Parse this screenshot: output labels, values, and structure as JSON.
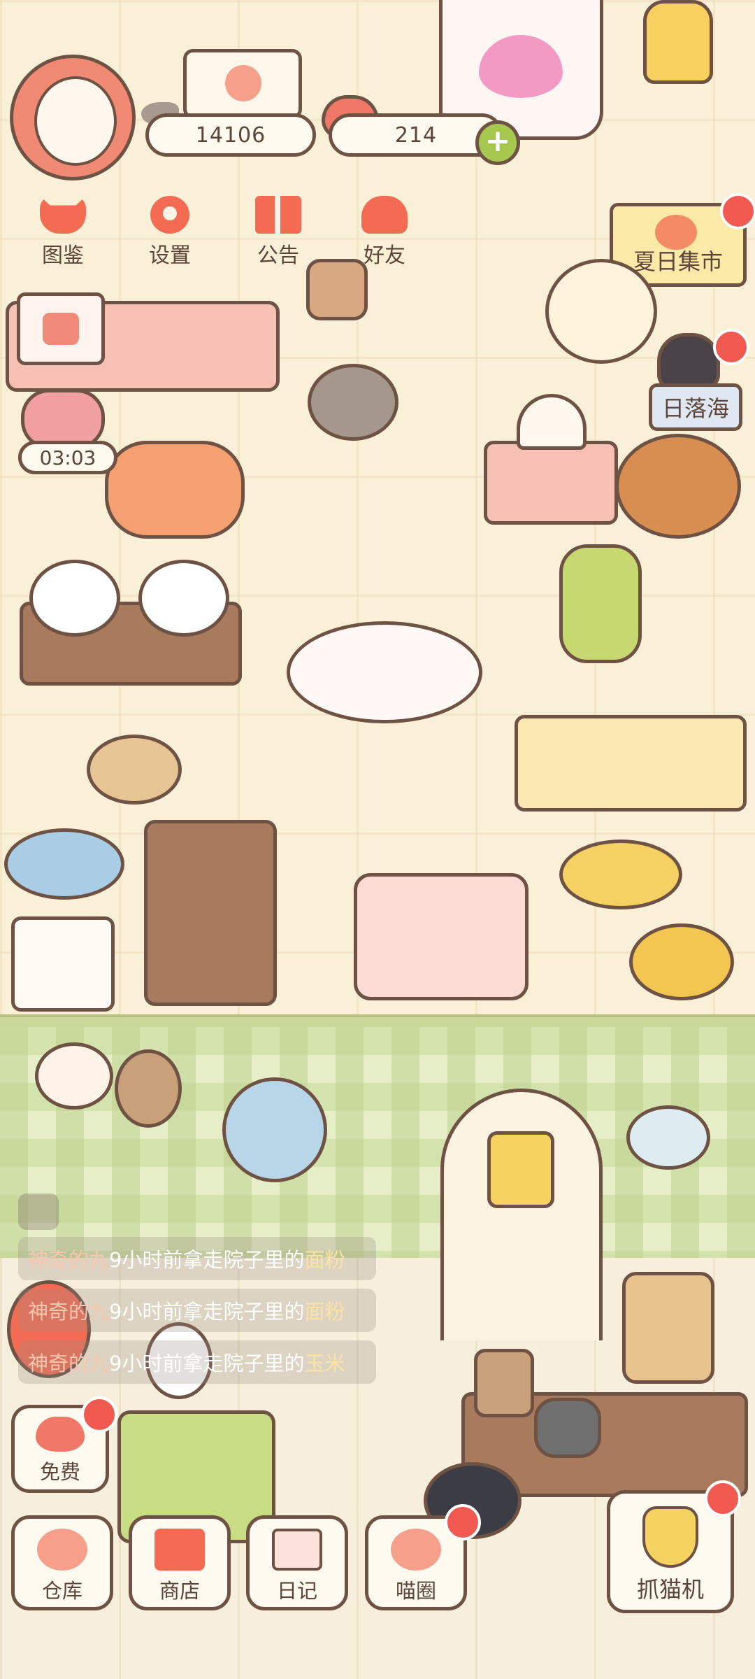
{
  "hud": {
    "fish_count": "14106",
    "heart_count": "214",
    "plus_label": "+"
  },
  "menu": [
    {
      "label": "图鉴",
      "icon": "catalog-cat-icon"
    },
    {
      "label": "设置",
      "icon": "gear-icon"
    },
    {
      "label": "公告",
      "icon": "gift-icon"
    },
    {
      "label": "好友",
      "icon": "friends-icon"
    }
  ],
  "events": {
    "summer_market": "夏日集市",
    "sunset_sea": "日落海"
  },
  "timer": "03:03",
  "feed": [
    {
      "name": "神奇的九",
      "text": "9小时前拿走院子里的",
      "item": "面粉"
    },
    {
      "name": "神奇的九",
      "text": "9小时前拿走院子里的",
      "item": "面粉"
    },
    {
      "name": "神奇的九",
      "text": "9小时前拿走院子里的",
      "item": "玉米"
    }
  ],
  "buttons": {
    "free": "免费",
    "warehouse": "仓库",
    "shop": "商店",
    "diary": "日记",
    "cat_circle": "喵圈",
    "claw_machine": "抓猫机"
  },
  "colors": {
    "outline": "#6e5244",
    "accent": "#f26b52",
    "notification": "#f05a50",
    "floor_top": "#faf0d8",
    "floor_green": "#e6eec8"
  }
}
